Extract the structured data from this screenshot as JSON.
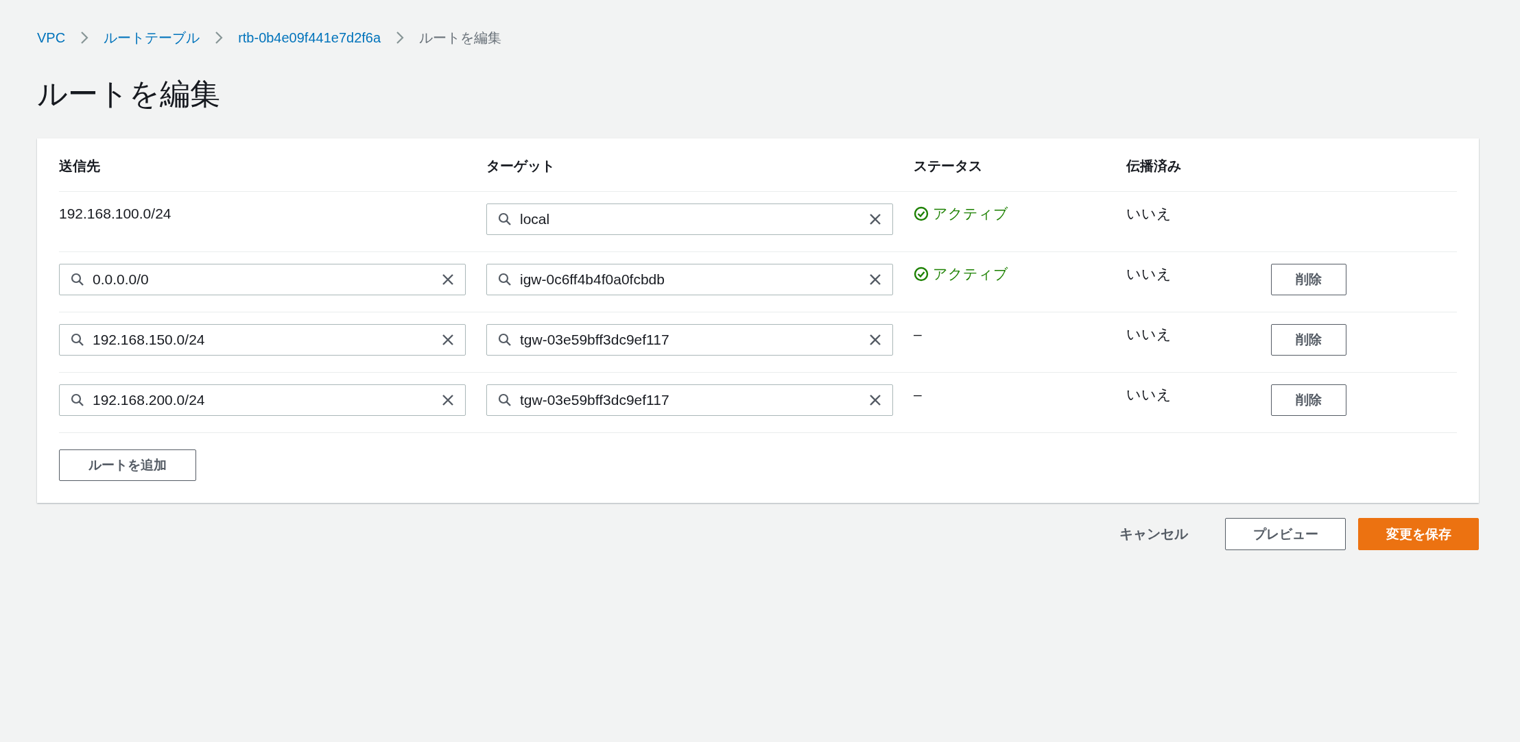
{
  "breadcrumb": [
    {
      "label": "VPC",
      "link": true
    },
    {
      "label": "ルートテーブル",
      "link": true
    },
    {
      "label": "rtb-0b4e09f441e7d2f6a",
      "link": true
    },
    {
      "label": "ルートを編集",
      "link": false
    }
  ],
  "page_title": "ルートを編集",
  "table": {
    "columns": [
      "送信先",
      "ターゲット",
      "ステータス",
      "伝播済み"
    ],
    "rows": [
      {
        "destination": {
          "kind": "text",
          "value": "192.168.100.0/24"
        },
        "target": "local",
        "status": {
          "kind": "active",
          "label": "アクティブ"
        },
        "propagated": "いいえ"
      },
      {
        "destination": {
          "kind": "field",
          "value": "0.0.0.0/0"
        },
        "target": "igw-0c6ff4b4f0a0fcbdb",
        "status": {
          "kind": "active",
          "label": "アクティブ"
        },
        "propagated": "いいえ",
        "delete_label": "削除"
      },
      {
        "destination": {
          "kind": "field",
          "value": "192.168.150.0/24"
        },
        "target": "tgw-03e59bff3dc9ef117",
        "status": {
          "kind": "none",
          "label": "–"
        },
        "propagated": "いいえ",
        "delete_label": "削除"
      },
      {
        "destination": {
          "kind": "field",
          "value": "192.168.200.0/24"
        },
        "target": "tgw-03e59bff3dc9ef117",
        "status": {
          "kind": "none",
          "label": "–"
        },
        "propagated": "いいえ",
        "delete_label": "削除"
      }
    ]
  },
  "add_route_button": "ルートを追加",
  "footer": {
    "cancel": "キャンセル",
    "preview": "プレビュー",
    "save": "変更を保存"
  }
}
